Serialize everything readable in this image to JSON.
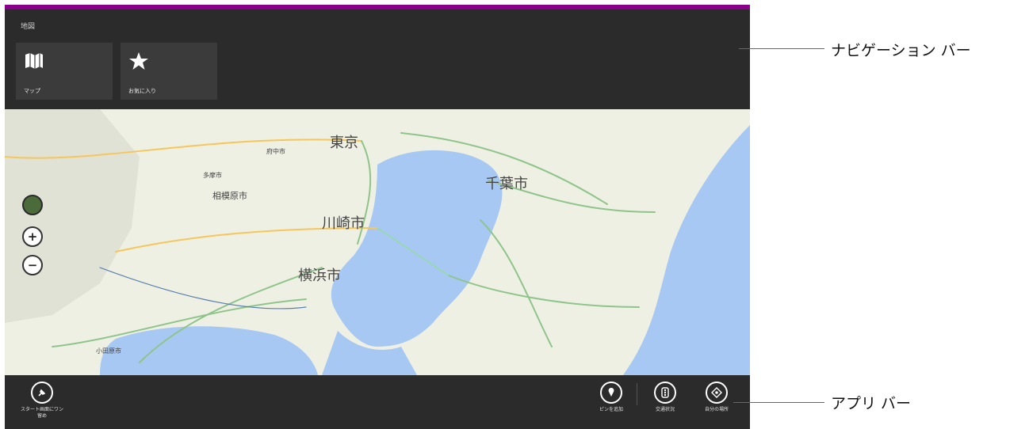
{
  "nav": {
    "title": "地図",
    "tiles": [
      {
        "label": "マップ",
        "icon": "map-icon"
      },
      {
        "label": "お気に入り",
        "icon": "star-icon"
      }
    ]
  },
  "map": {
    "cities": {
      "tokyo": "東京",
      "kawasaki": "川崎市",
      "yokohama": "横浜市",
      "chiba": "千葉市",
      "sagamihara": "相模原市",
      "tama": "多摩市",
      "fuchu": "府中市",
      "odawara": "小田原市"
    },
    "controls": [
      "compass-icon",
      "zoom-in-icon",
      "zoom-out-icon"
    ]
  },
  "appbar": {
    "pin_label_line1": "スタート画面にワン",
    "pin_label_line2": "留め",
    "buttons": [
      {
        "label": "ピンを追加",
        "icon": "add-pin-icon"
      },
      {
        "label": "交通状況",
        "icon": "traffic-icon"
      },
      {
        "label": "自分の場所",
        "icon": "my-location-icon"
      }
    ]
  },
  "callouts": {
    "navbar": "ナビゲーション バー",
    "appbar": "アプリ バー"
  },
  "colors": {
    "accent": "#8a008a",
    "bar": "#2b2b2b",
    "water": "#a6c8f3"
  }
}
